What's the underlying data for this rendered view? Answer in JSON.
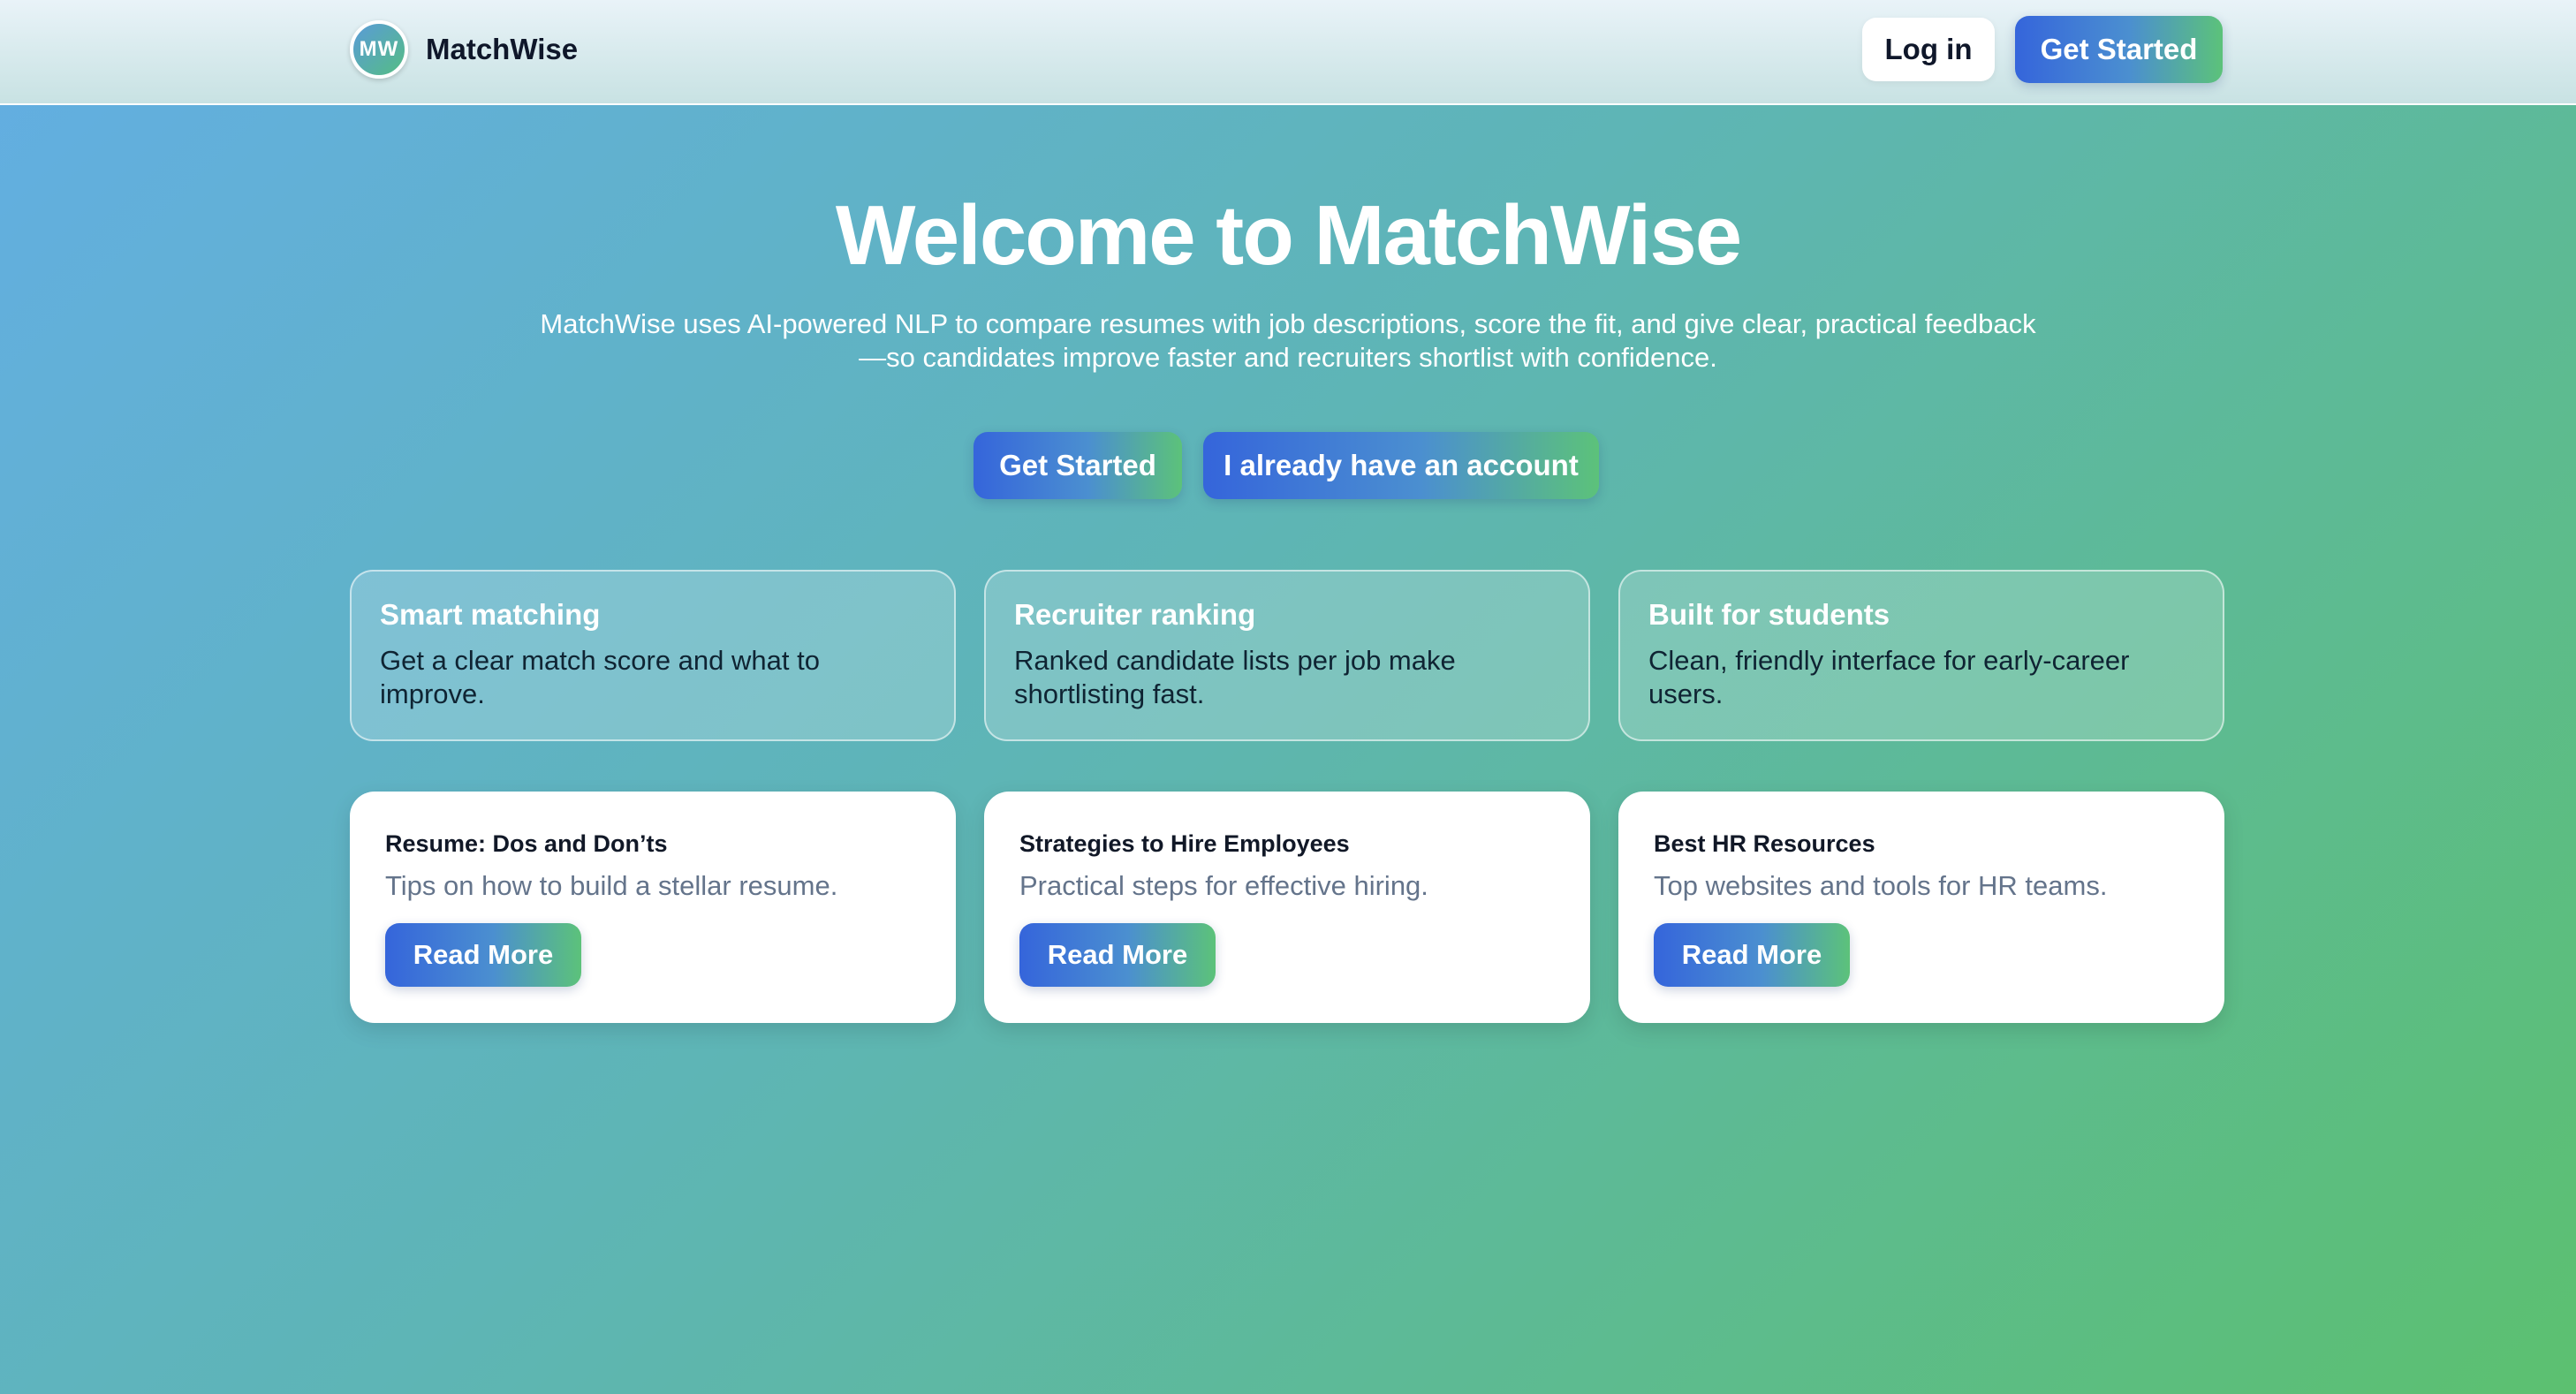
{
  "header": {
    "logo_text": "MW",
    "brand_name": "MatchWise",
    "login_label": "Log in",
    "get_started_label": "Get Started"
  },
  "hero": {
    "title": "Welcome to MatchWise",
    "subtitle_line1": "MatchWise uses AI-powered NLP to compare resumes with job descriptions, score the fit, and give clear, practical feedback",
    "subtitle_line2": "—so candidates improve faster and recruiters shortlist with confidence.",
    "primary_button": "Get Started",
    "secondary_button": "I already have an account"
  },
  "features": [
    {
      "title": "Smart matching",
      "text": "Get a clear match score and what to improve."
    },
    {
      "title": "Recruiter ranking",
      "text": "Ranked candidate lists per job make shortlisting fast."
    },
    {
      "title": "Built for students",
      "text": "Clean, friendly interface for early-career users."
    }
  ],
  "articles": [
    {
      "title": "Resume: Dos and Don’ts",
      "text": "Tips on how to build a stellar resume.",
      "button": "Read More"
    },
    {
      "title": "Strategies to Hire Employees",
      "text": "Practical steps for effective hiring.",
      "button": "Read More"
    },
    {
      "title": "Best HR Resources",
      "text": "Top websites and tools for HR teams.",
      "button": "Read More"
    }
  ],
  "colors": {
    "accent_start": "#3565db",
    "accent_end": "#5cc27a",
    "text_dark": "#0f172a"
  }
}
